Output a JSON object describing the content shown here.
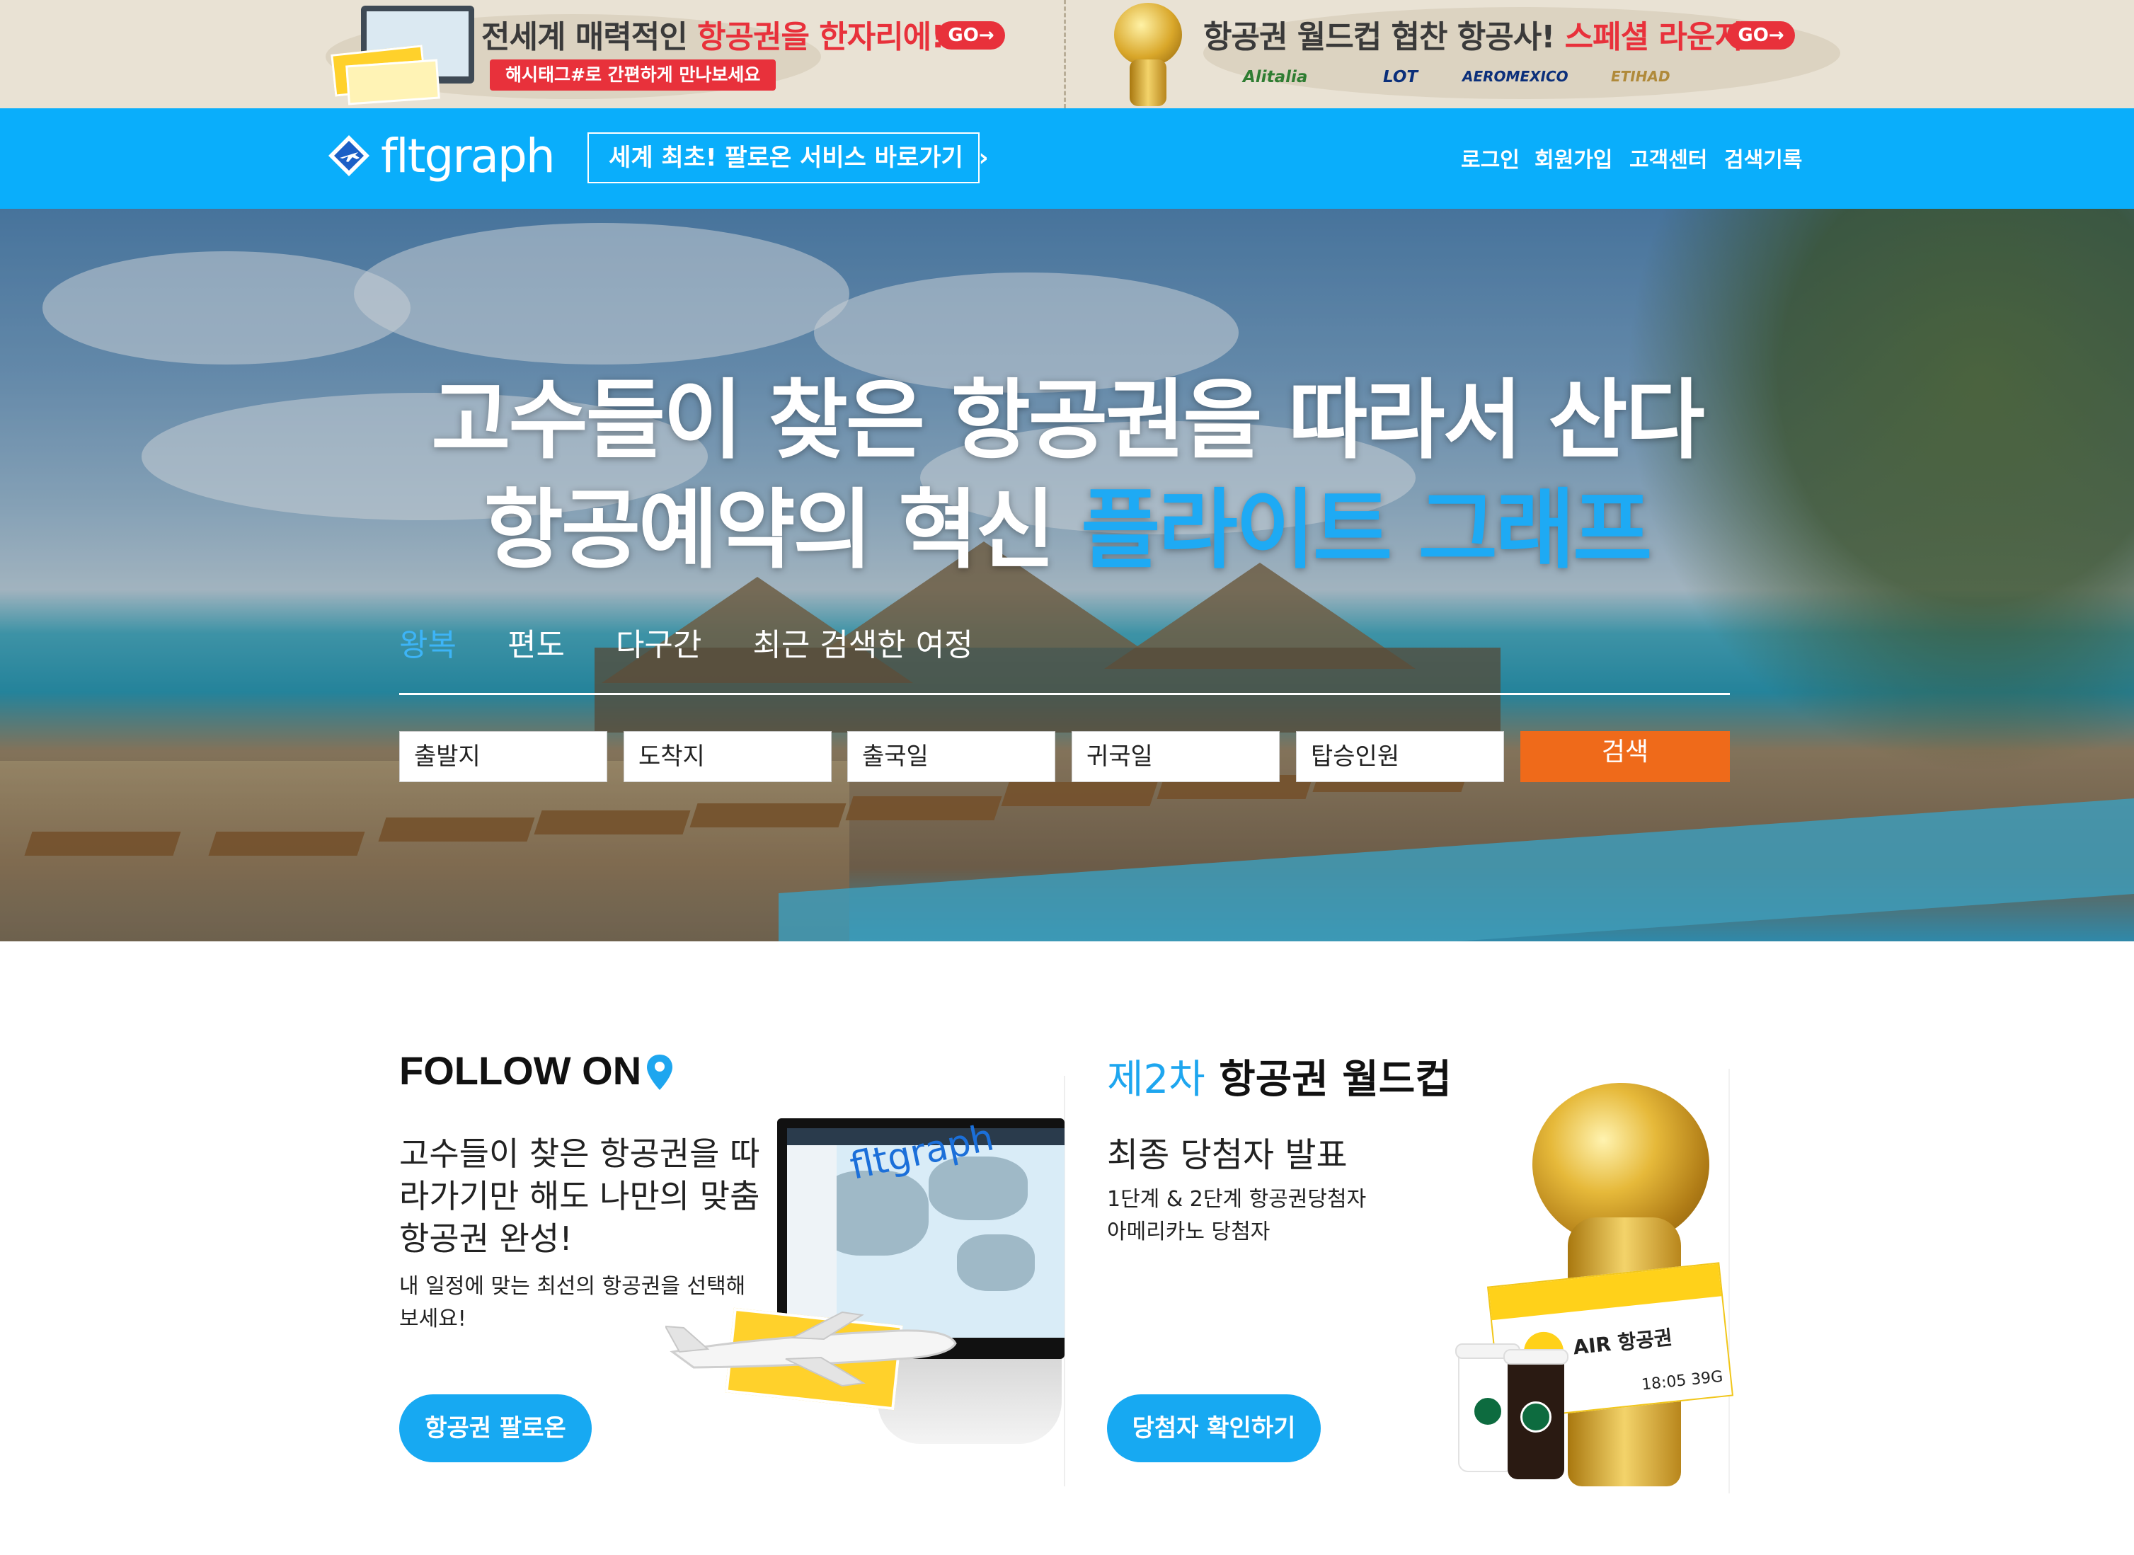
{
  "ad_banner": {
    "left": {
      "title_prefix": "전세계 매력적인 ",
      "title_highlight": "항공권을 한자리에!",
      "go_label": "GO→",
      "hashtag_text": "해시태그#로 간편하게 만나보세요"
    },
    "right": {
      "title_prefix": "항공권 월드컵 협찬 항공사! ",
      "title_highlight": "스페셜 라운지",
      "go_label": "GO→",
      "airlines": [
        "Alitalia",
        "LOT",
        "AEROMEXICO",
        "ETIHAD"
      ]
    }
  },
  "header": {
    "logo_text": "fltgraph",
    "follow_service_label": "세계 최초! 팔로온 서비스 바로가기",
    "nav": [
      "로그인",
      "회원가입",
      "고객센터",
      "검색기록"
    ]
  },
  "hero": {
    "headline_line1": "고수들이 찾은 항공권을 따라서 산다",
    "headline_line2_prefix": "항공예약의 혁신 ",
    "headline_line2_accent": "플라이트 그래프",
    "tabs": [
      "왕복",
      "편도",
      "다구간",
      "최근 검색한 여정"
    ],
    "active_tab": "왕복",
    "search": {
      "origin": "출발지",
      "destination": "도착지",
      "depart_date": "출국일",
      "return_date": "귀국일",
      "passengers": "탑승인원",
      "button_label": "검색"
    }
  },
  "follow_card": {
    "title": "FOLLOW ON",
    "headline": "고수들이 찾은 항공권을 따라가기만 해도 나만의 맞춤 항공권 완성!",
    "sub": "내 일정에 맞는 최선의 항공권을 선택해 보세요!",
    "button_label": "항공권 팔로온",
    "illustration_logo": "fltgraph"
  },
  "worldcup_card": {
    "title_accent": "제2차",
    "title_rest": " 항공권 월드컵",
    "headline": "최종 당첨자 발표",
    "sub_line1": "1단계 & 2단계 항공권당첨자",
    "sub_line2": "아메리카노 당첨자",
    "button_label": "당첨자 확인하기",
    "ticket_label": "AIR 항공권",
    "ticket_time": "18:05   39G"
  },
  "colors": {
    "header_blue": "#0aaefb",
    "accent_blue": "#1ea6ef",
    "search_orange": "#ef6a1a",
    "ad_red": "#e8313b"
  },
  "icons": {
    "logo_mark": "airplane-diamond-icon",
    "pin": "map-pin-icon",
    "chevron": "chevron-right-icon"
  }
}
